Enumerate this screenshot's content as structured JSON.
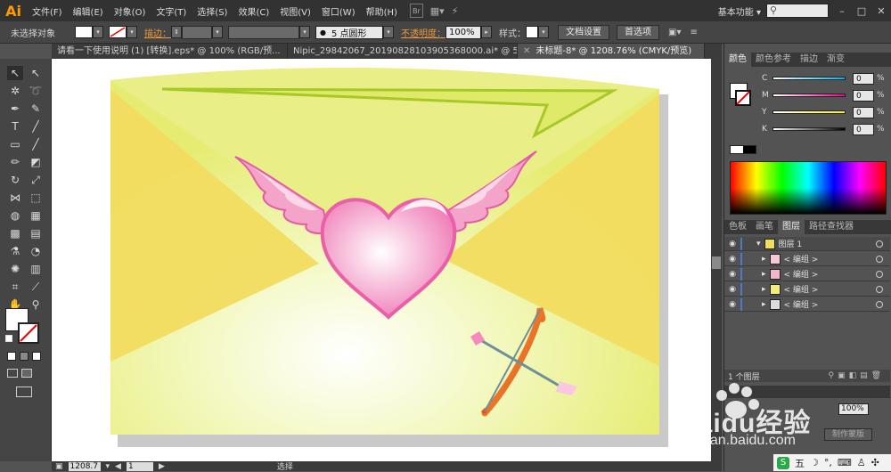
{
  "app": {
    "logo": "Ai"
  },
  "menu": [
    "文件(F)",
    "编辑(E)",
    "对象(O)",
    "文字(T)",
    "选择(S)",
    "效果(C)",
    "视图(V)",
    "窗口(W)",
    "帮助(H)"
  ],
  "menu_icons": {
    "bridge": "Br",
    "arrange": "▦▾"
  },
  "workspace": "基本功能",
  "control": {
    "selection": "未选择对象",
    "stroke_label": "描边：",
    "brush": "5 点圆形",
    "opacity_label": "不透明度：",
    "opacity": "100%",
    "style_label": "样式：",
    "doc_setup": "文档设置",
    "preferences": "首选项"
  },
  "tabs": [
    {
      "label": "请看一下使用说明 (1) [转换].eps* @ 100% (RGB/预..."
    },
    {
      "label": "Nipic_29842067_20190828103905368000.ai* @ 55..."
    },
    {
      "label": "未标题-8* @ 1208.76% (CMYK/预览)"
    }
  ],
  "status": {
    "zoom": "1208.7",
    "page": "1",
    "mode": "选择"
  },
  "color_panel": {
    "tabs": [
      "颜色",
      "颜色参考",
      "描边",
      "渐变"
    ],
    "channels": [
      {
        "name": "C",
        "value": "0",
        "grad": "linear-gradient(90deg,#fff,#00aeef)"
      },
      {
        "name": "M",
        "value": "0",
        "grad": "linear-gradient(90deg,#fff,#ec008c)"
      },
      {
        "name": "Y",
        "value": "0",
        "grad": "linear-gradient(90deg,#fff,#fff200)"
      },
      {
        "name": "K",
        "value": "0",
        "grad": "linear-gradient(90deg,#fff,#000)"
      }
    ],
    "unit": "%"
  },
  "layers_panel": {
    "tabs": [
      "色板",
      "画笔",
      "图层",
      "路径查找器"
    ],
    "layer": "图层 1",
    "groups": [
      {
        "name": "< 编组 >",
        "thumb": "#f7c8d8"
      },
      {
        "name": "< 编组 >",
        "thumb": "#f4b6c8"
      },
      {
        "name": "< 编组 >",
        "thumb": "#f2ee7a"
      },
      {
        "name": "< 编组 >",
        "thumb": "#dcdcdc"
      }
    ],
    "count": "1 个图层"
  },
  "transparency": {
    "value": "100%",
    "mask_button": "制作蒙版"
  },
  "watermark": {
    "brand": "Baidu经验",
    "url": "jingyan.baidu.com"
  },
  "taskbar": {
    "ime": "五"
  },
  "colors": {
    "envelope": "#f3de5c",
    "heart": "#f26fae",
    "bow": "#f07a2a"
  }
}
